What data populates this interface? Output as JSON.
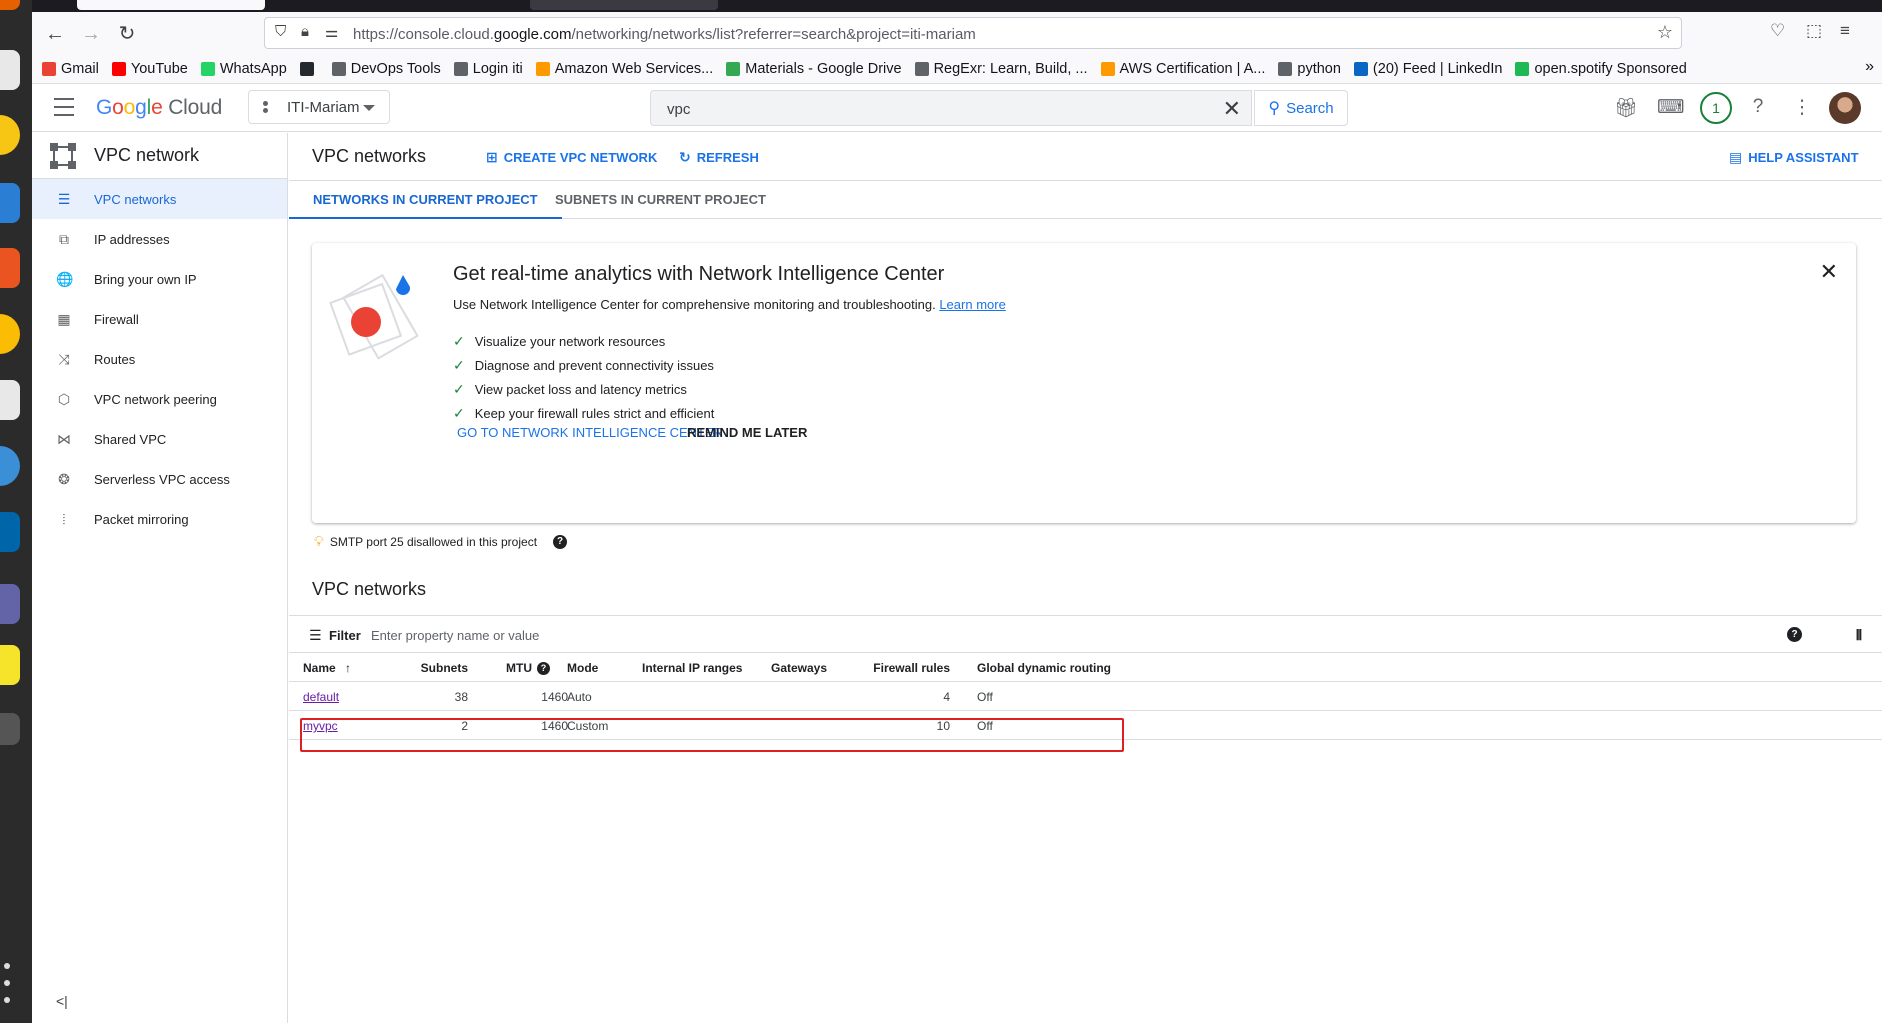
{
  "browser": {
    "url_prefix": "https://console.cloud.",
    "url_domain": "google.com",
    "url_suffix": "/networking/networks/list?referrer=search&project=iti-mariam",
    "bookmarks": [
      {
        "label": "Gmail",
        "color": "#ea4335"
      },
      {
        "label": "YouTube",
        "color": "#ff0000"
      },
      {
        "label": "WhatsApp",
        "color": "#25d366"
      },
      {
        "label": "",
        "color": "#24292f"
      },
      {
        "label": "DevOps Tools",
        "color": "#5f6368"
      },
      {
        "label": "Login iti",
        "color": "#5f6368"
      },
      {
        "label": "Amazon Web Services...",
        "color": "#ff9900"
      },
      {
        "label": "Materials - Google Drive",
        "color": "#34a853"
      },
      {
        "label": "RegExr: Learn, Build, ...",
        "color": "#5f6368"
      },
      {
        "label": "AWS Certification | A...",
        "color": "#ff9900"
      },
      {
        "label": "python",
        "color": "#5f6368"
      },
      {
        "label": "(20) Feed | LinkedIn",
        "color": "#0a66c2"
      },
      {
        "label": "open.spotify Sponsored",
        "color": "#1db954"
      }
    ]
  },
  "topbar": {
    "logo_g": "G",
    "logo_o1": "o",
    "logo_o2": "o",
    "logo_g2": "g",
    "logo_l": "l",
    "logo_e": "e",
    "logo_cloud": "Cloud",
    "project": "ITI-Mariam",
    "search_value": "vpc",
    "search_button": "Search",
    "notifications": "1"
  },
  "sidebar": {
    "title": "VPC network",
    "items": [
      {
        "label": "VPC networks",
        "icon": "vpc-networks-icon",
        "glyph": "☰"
      },
      {
        "label": "IP addresses",
        "icon": "ip-addresses-icon",
        "glyph": "⧉"
      },
      {
        "label": "Bring your own IP",
        "icon": "globe-icon",
        "glyph": "🌐"
      },
      {
        "label": "Firewall",
        "icon": "firewall-icon",
        "glyph": "▦"
      },
      {
        "label": "Routes",
        "icon": "routes-icon",
        "glyph": "⤨"
      },
      {
        "label": "VPC network peering",
        "icon": "peering-icon",
        "glyph": "⬡"
      },
      {
        "label": "Shared VPC",
        "icon": "shared-vpc-icon",
        "glyph": "⋈"
      },
      {
        "label": "Serverless VPC access",
        "icon": "serverless-icon",
        "glyph": "❂"
      },
      {
        "label": "Packet mirroring",
        "icon": "packet-mirroring-icon",
        "glyph": "⦙"
      }
    ]
  },
  "main": {
    "title": "VPC networks",
    "create_label": "CREATE VPC NETWORK",
    "refresh_label": "REFRESH",
    "help_label": "HELP ASSISTANT",
    "tabs": [
      "NETWORKS IN CURRENT PROJECT",
      "SUBNETS IN CURRENT PROJECT"
    ],
    "promo": {
      "title": "Get real-time analytics with Network Intelligence Center",
      "desc": "Use Network Intelligence Center for comprehensive monitoring and troubleshooting.",
      "learn_more": "Learn more",
      "checks": [
        "Visualize your network resources",
        "Diagnose and prevent connectivity issues",
        "View packet loss and latency metrics",
        "Keep your firewall rules strict and efficient"
      ],
      "go_button": "GO TO NETWORK INTELLIGENCE CENTER",
      "remind_button": "REMIND ME LATER"
    },
    "smtp_notice": "SMTP port 25 disallowed in this project",
    "section_title": "VPC networks",
    "filter_label": "Filter",
    "filter_placeholder": "Enter property name or value",
    "columns": [
      "Name",
      "Subnets",
      "MTU",
      "Mode",
      "Internal IP ranges",
      "Gateways",
      "Firewall rules",
      "Global dynamic routing"
    ],
    "rows": [
      {
        "name": "default",
        "subnets": "38",
        "mtu": "1460",
        "mode": "Auto",
        "ip_ranges": "",
        "gateways": "",
        "firewall": "4",
        "routing": "Off"
      },
      {
        "name": "myvpc",
        "subnets": "2",
        "mtu": "1460",
        "mode": "Custom",
        "ip_ranges": "",
        "gateways": "",
        "firewall": "10",
        "routing": "Off"
      }
    ]
  }
}
